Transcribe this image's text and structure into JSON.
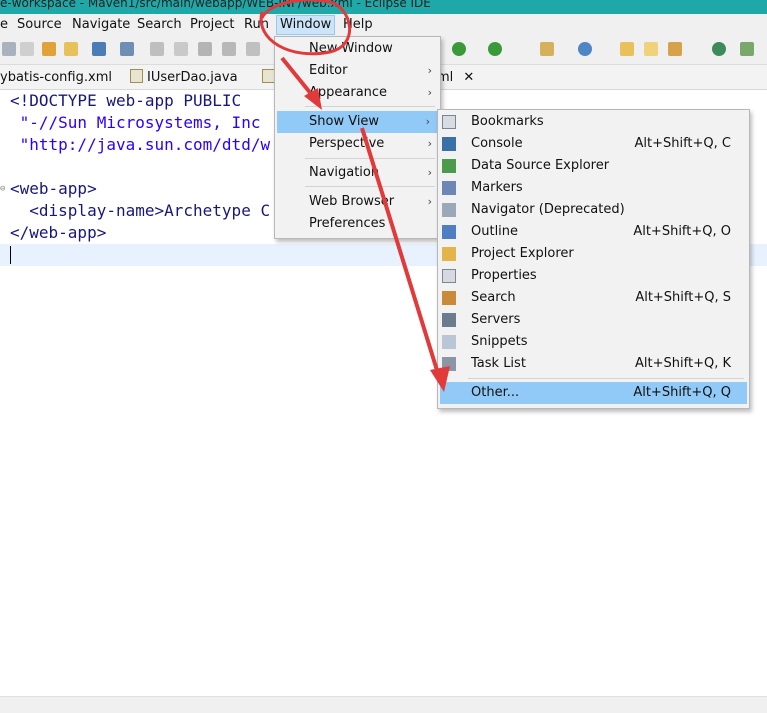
{
  "window": {
    "title": "e-workspace - Maven1/src/main/webapp/WEB-INF/web.xml - Eclipse IDE"
  },
  "menubar": [
    "Source",
    "Navigate",
    "Search",
    "Project",
    "Run",
    "Window",
    "Help"
  ],
  "tabs": [
    "ybatis-config.xml",
    "IUserDao.java",
    "ml"
  ],
  "editor": {
    "lines": [
      "<!DOCTYPE web-app PUBLIC",
      " \"-//Sun Microsystems, Inc",
      " \"http://java.sun.com/dtd/w",
      "",
      "<web-app>",
      "  <display-name>Archetype C",
      "</web-app>"
    ]
  },
  "window_menu": {
    "items": [
      "New Window",
      "Editor",
      "Appearance",
      "Show View",
      "Perspective",
      "Navigation",
      "Web Browser",
      "Preferences"
    ]
  },
  "show_view_menu": {
    "items": [
      {
        "label": "Bookmarks",
        "shortcut": "",
        "icon": "bookmark-icon"
      },
      {
        "label": "Console",
        "shortcut": "Alt+Shift+Q, C",
        "icon": "console-icon"
      },
      {
        "label": "Data Source Explorer",
        "shortcut": "",
        "icon": "data-source-icon"
      },
      {
        "label": "Markers",
        "shortcut": "",
        "icon": "markers-icon"
      },
      {
        "label": "Navigator (Deprecated)",
        "shortcut": "",
        "icon": "navigator-icon"
      },
      {
        "label": "Outline",
        "shortcut": "Alt+Shift+Q, O",
        "icon": "outline-icon"
      },
      {
        "label": "Project Explorer",
        "shortcut": "",
        "icon": "project-explorer-icon"
      },
      {
        "label": "Properties",
        "shortcut": "",
        "icon": "properties-icon"
      },
      {
        "label": "Search",
        "shortcut": "Alt+Shift+Q, S",
        "icon": "search-icon"
      },
      {
        "label": "Servers",
        "shortcut": "",
        "icon": "servers-icon"
      },
      {
        "label": "Snippets",
        "shortcut": "",
        "icon": "snippets-icon"
      },
      {
        "label": "Task List",
        "shortcut": "Alt+Shift+Q, K",
        "icon": "task-list-icon"
      },
      {
        "label": "Other...",
        "shortcut": "Alt+Shift+Q, Q",
        "icon": ""
      }
    ]
  },
  "annotation_color": "#e03a3a",
  "highlight_color": "#91c9f7"
}
